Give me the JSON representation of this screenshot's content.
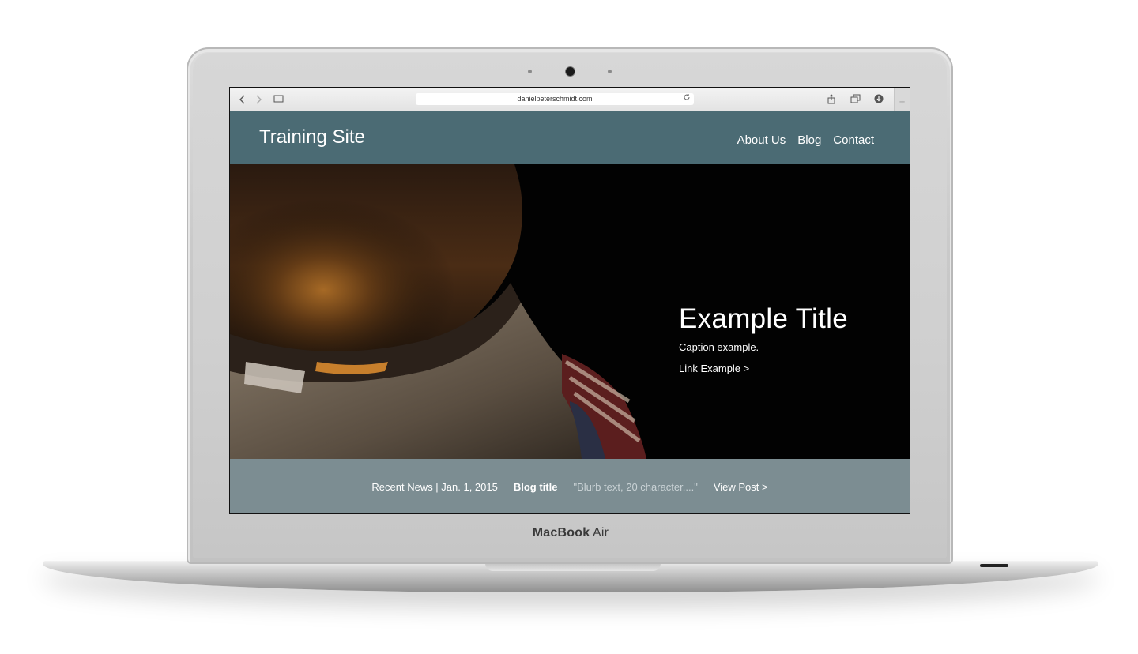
{
  "device": {
    "brand_strong": "MacBook",
    "brand_rest": " Air"
  },
  "browser": {
    "back_icon": "chevron-left-icon",
    "forward_icon": "chevron-right-icon",
    "sidebar_icon": "sidebar-icon",
    "url": "danielpeterschmidt.com",
    "reload_icon": "reload-icon",
    "share_icon": "share-icon",
    "tabs_icon": "tabs-icon",
    "download_icon": "download-icon",
    "newtab_icon": "plus-icon"
  },
  "site": {
    "title": "Training Site",
    "nav": [
      {
        "label": "About Us"
      },
      {
        "label": "Blog"
      },
      {
        "label": "Contact"
      }
    ]
  },
  "hero": {
    "title": "Example Title",
    "caption": "Caption example.",
    "link": "Link Example >"
  },
  "news": {
    "label": "Recent News | Jan. 1, 2015",
    "blog_title": "Blog title",
    "blurb": "\"Blurb text, 20 character....\"",
    "view_post": "View Post >"
  },
  "colors": {
    "nav_bg": "#4b6b74",
    "news_bg": "#7c8d92",
    "hero_bg": "#020202"
  }
}
